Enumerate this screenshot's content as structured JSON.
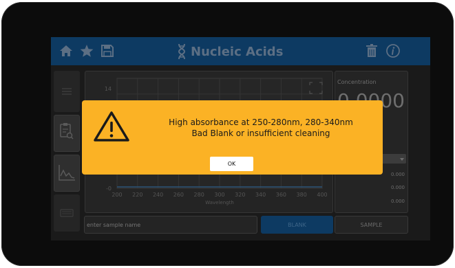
{
  "app": {
    "title": "Nucleic Acids"
  },
  "header": {
    "icons": [
      "home-icon",
      "star-icon",
      "save-icon",
      "dna-icon",
      "trash-icon",
      "info-icon"
    ]
  },
  "chart_data": {
    "type": "line",
    "xlabel": "Wavelength",
    "ylabel": "",
    "x_ticks": [
      "200",
      "220",
      "240",
      "260",
      "280",
      "300",
      "320",
      "340",
      "360",
      "380",
      "400"
    ],
    "y_ticks": [
      "14",
      "-0"
    ],
    "xlim": [
      200,
      400
    ],
    "series": [
      {
        "x": [
          200,
          400
        ],
        "y": [
          0,
          0
        ]
      }
    ],
    "grid": true
  },
  "concentration": {
    "label": "Concentration",
    "value": "0.0000",
    "readings": [
      "0.000",
      "0.000",
      "0.000"
    ]
  },
  "footer": {
    "sample_placeholder": "enter sample name",
    "blank_label": "BLANK",
    "sample_label": "SAMPLE"
  },
  "dialog": {
    "line1": "High absorbance at 250-280nm, 280-340nm",
    "line2": "Bad Blank or insufficient cleaning",
    "ok_label": "OK"
  },
  "colors": {
    "header_bg": "#0d3a62",
    "dialog_bg": "#fbb225",
    "device_bezel": "#0c0c0c"
  }
}
